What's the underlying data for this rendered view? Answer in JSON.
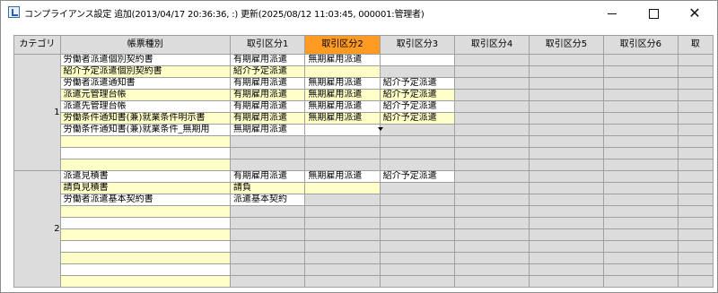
{
  "window": {
    "title": "コンプライアンス設定 追加(2013/04/17 20:36:36, :) 更新(2025/08/12 11:03:45, 000001:管理者)",
    "controls": [
      "minimize-icon",
      "maximize-icon",
      "close-icon"
    ]
  },
  "grid": {
    "headers": [
      "カテゴリ",
      "帳票種別",
      "取引区分1",
      "取引区分2",
      "取引区分3",
      "取引区分4",
      "取引区分5",
      "取引区分6",
      "取"
    ],
    "active_header_index": 3,
    "active_header_color": "#ff9a22",
    "categories": [
      {
        "label": "1",
        "rows": [
          {
            "doc": "労働者派遣個別契約書",
            "v1": "有期雇用派遣",
            "v2": "無期雇用派遣",
            "v3": ""
          },
          {
            "doc": "紹介予定派遣個別契約書",
            "v1": "紹介予定派遣",
            "v2": "",
            "v3": ""
          },
          {
            "doc": "労働者派遣通知書",
            "v1": "有期雇用派遣",
            "v2": "無期雇用派遣",
            "v3": "紹介予定派遣"
          },
          {
            "doc": "派遣元管理台帳",
            "v1": "有期雇用派遣",
            "v2": "無期雇用派遣",
            "v3": "紹介予定派遣"
          },
          {
            "doc": "派遣先管理台帳",
            "v1": "有期雇用派遣",
            "v2": "無期雇用派遣",
            "v3": "紹介予定派遣"
          },
          {
            "doc": "労働条件通知書(兼)就業条件明示書",
            "v1": "有期雇用派遣",
            "v2": "無期雇用派遣",
            "v3": "紹介予定派遣"
          },
          {
            "doc": "労働条件通知書(兼)就業条件_無期用",
            "v1": "無期雇用派遣",
            "v2": "",
            "v3": ""
          }
        ]
      },
      {
        "label": "2",
        "rows": [
          {
            "doc": "派遣見積書",
            "v1": "有期雇用派遣",
            "v2": "無期雇用派遣",
            "v3": "紹介予定派遣"
          },
          {
            "doc": "請負見積書",
            "v1": "請負",
            "v2": "",
            "v3": ""
          },
          {
            "doc": "労働者派遣基本契約書",
            "v1": "派遣基本契約",
            "v2": "",
            "v3": ""
          }
        ]
      }
    ],
    "editing_cell": {
      "row": "労働条件通知書(兼)就業条件_無期用",
      "column": "取引区分1",
      "value": "無期雇用派遣",
      "highlight_color": "#e00000",
      "icon": "dropdown-arrow-icon"
    }
  }
}
